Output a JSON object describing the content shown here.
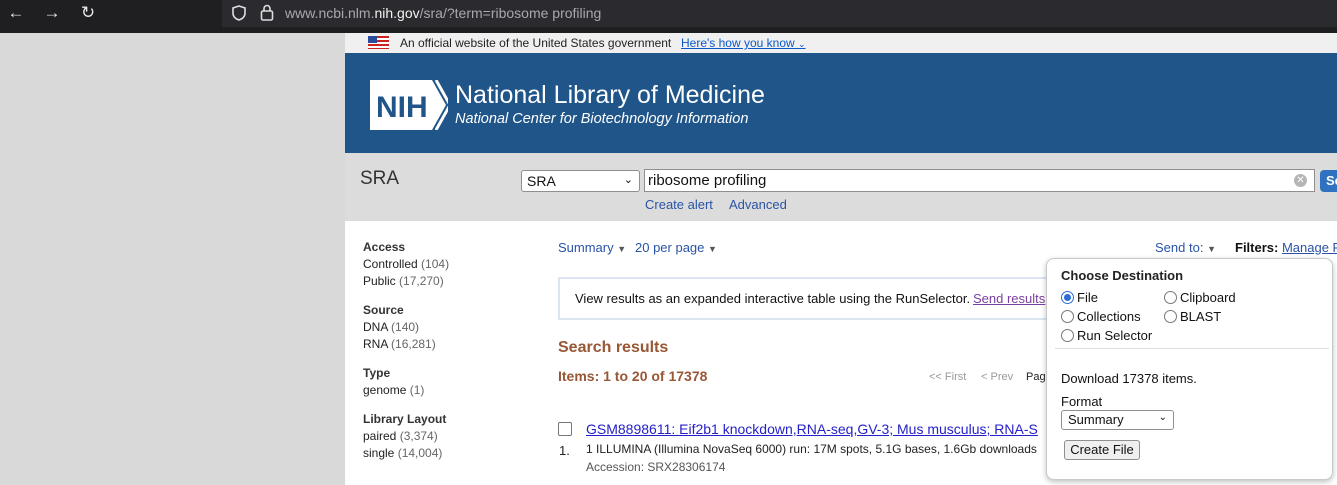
{
  "browser": {
    "url_prefix": "www.ncbi.nlm.",
    "url_domain": "nih.gov",
    "url_path": "/sra/?term=ribosome profiling"
  },
  "gov_banner": {
    "text": "An official website of the United States government",
    "link": "Here's how you know"
  },
  "header": {
    "logo": "NIH",
    "title": "National Library of Medicine",
    "subtitle": "National Center for Biotechnology Information"
  },
  "search": {
    "db_title": "SRA",
    "db_select": "SRA",
    "term": "ribosome profiling",
    "button": "Se",
    "create_alert": "Create alert",
    "advanced": "Advanced"
  },
  "sidebar": {
    "groups": [
      {
        "title": "Access",
        "items": [
          {
            "label": "Controlled",
            "count": "(104)"
          },
          {
            "label": "Public",
            "count": "(17,270)"
          }
        ]
      },
      {
        "title": "Source",
        "items": [
          {
            "label": "DNA",
            "count": "(140)"
          },
          {
            "label": "RNA",
            "count": "(16,281)"
          }
        ]
      },
      {
        "title": "Type",
        "items": [
          {
            "label": "genome",
            "count": "(1)"
          }
        ]
      },
      {
        "title": "Library Layout",
        "items": [
          {
            "label": "paired",
            "count": "(3,374)"
          },
          {
            "label": "single",
            "count": "(14,004)"
          }
        ]
      }
    ]
  },
  "toolbar": {
    "format": "Summary",
    "per_page": "20 per page",
    "send_to": "Send to:",
    "filters_label": "Filters:",
    "manage_filters": "Manage F"
  },
  "runselector": {
    "text": "View results as an expanded interactive table using the RunSelector.",
    "link": "Send results"
  },
  "results": {
    "heading": "Search results",
    "items": "Items: 1 to 20 of 17378",
    "first": "<< First",
    "prev": "< Prev",
    "page": "Pag",
    "rows": [
      {
        "num": "1.",
        "title": "GSM8898611: Eif2b1 knockdown,RNA-seq,GV-3; Mus musculus; RNA-S",
        "desc": "1 ILLUMINA (Illumina NovaSeq 6000) run: 17M spots, 5.1G bases, 1.6Gb downloads",
        "accession": "Accession: SRX28306174"
      }
    ]
  },
  "popup": {
    "heading": "Choose Destination",
    "options": [
      "File",
      "Clipboard",
      "Collections",
      "BLAST",
      "Run Selector"
    ],
    "selected": "File",
    "download": "Download 17378 items.",
    "format_label": "Format",
    "format_value": "Summary",
    "create_button": "Create File"
  }
}
